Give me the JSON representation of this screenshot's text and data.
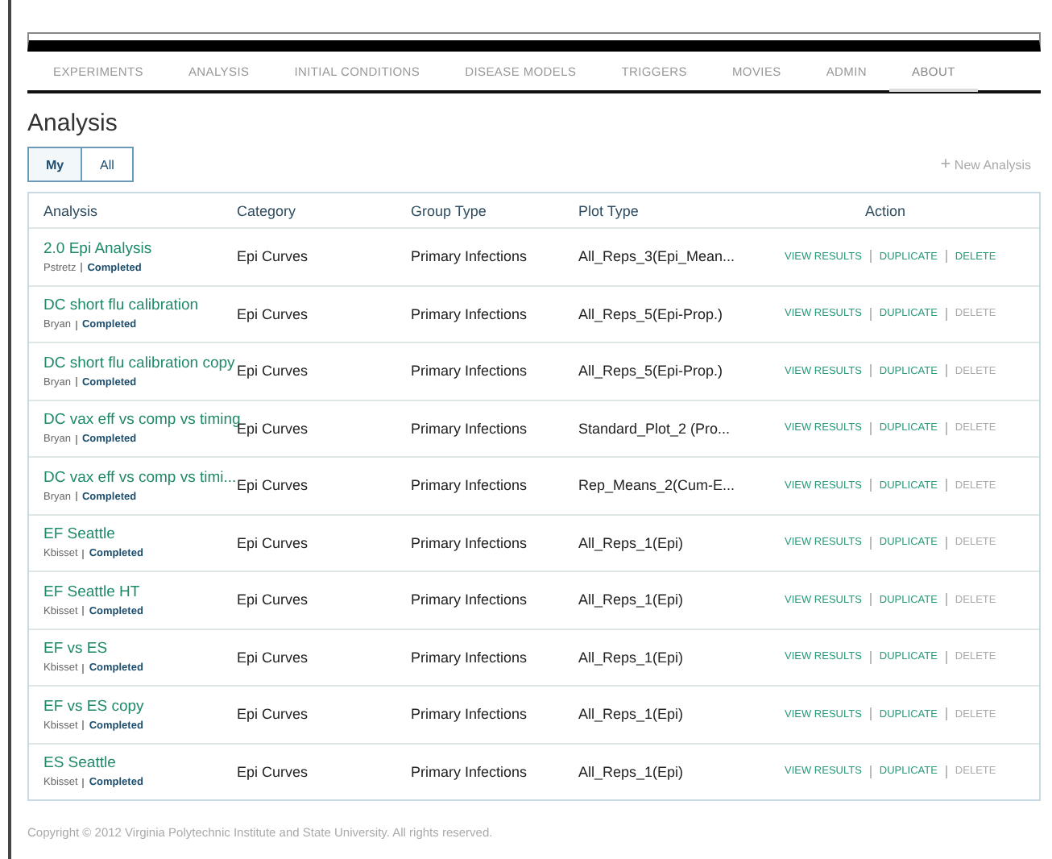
{
  "nav": [
    {
      "label": "EXPERIMENTS",
      "selected": false
    },
    {
      "label": "ANALYSIS",
      "selected": false
    },
    {
      "label": "INITIAL CONDITIONS",
      "selected": false
    },
    {
      "label": "DISEASE MODELS",
      "selected": false
    },
    {
      "label": "TRIGGERS",
      "selected": false
    },
    {
      "label": "MOVIES",
      "selected": false
    },
    {
      "label": "ADMIN",
      "selected": false
    },
    {
      "label": "ABOUT",
      "selected": true
    }
  ],
  "page_title": "Analysis",
  "filters": [
    {
      "label": "My",
      "selected": true
    },
    {
      "label": "All",
      "selected": false
    }
  ],
  "new_button": {
    "icon": "+",
    "label": "New Analysis"
  },
  "table": {
    "columns": [
      "Analysis",
      "Category",
      "Group Type",
      "Plot Type",
      "Action"
    ],
    "rows": [
      {
        "name": "2.0 Epi Analysis",
        "owner": "Pstretz",
        "status": "Completed",
        "category": "Epi Curves",
        "group_type": "Primary Infections",
        "plot_type": "All_Reps_3(Epi_Mean...",
        "actions": [
          {
            "label": "VIEW RESULTS",
            "disabled": false
          },
          {
            "label": "DUPLICATE",
            "disabled": false
          },
          {
            "label": "DELETE",
            "disabled": false
          }
        ]
      },
      {
        "name": "DC short flu calibration",
        "owner": "Bryan",
        "status": "Completed",
        "category": "Epi Curves",
        "group_type": "Primary Infections",
        "plot_type": "All_Reps_5(Epi-Prop.)",
        "actions": [
          {
            "label": "VIEW RESULTS",
            "disabled": false
          },
          {
            "label": "DUPLICATE",
            "disabled": false
          },
          {
            "label": "DELETE",
            "disabled": true
          }
        ]
      },
      {
        "name": "DC short flu calibration copy",
        "owner": "Bryan",
        "status": "Completed",
        "category": "Epi Curves",
        "group_type": "Primary Infections",
        "plot_type": "All_Reps_5(Epi-Prop.)",
        "actions": [
          {
            "label": "VIEW RESULTS",
            "disabled": false
          },
          {
            "label": "DUPLICATE",
            "disabled": false
          },
          {
            "label": "DELETE",
            "disabled": true
          }
        ]
      },
      {
        "name": "DC vax eff vs comp vs timing",
        "owner": "Bryan",
        "status": "Completed",
        "category": "Epi Curves",
        "group_type": "Primary Infections",
        "plot_type": "Standard_Plot_2 (Pro...",
        "actions": [
          {
            "label": "VIEW RESULTS",
            "disabled": false
          },
          {
            "label": "DUPLICATE",
            "disabled": false
          },
          {
            "label": "DELETE",
            "disabled": true
          }
        ]
      },
      {
        "name": "DC vax eff vs comp vs timi...",
        "owner": "Bryan",
        "status": "Completed",
        "category": "Epi Curves",
        "group_type": "Primary Infections",
        "plot_type": "Rep_Means_2(Cum-E...",
        "actions": [
          {
            "label": "VIEW RESULTS",
            "disabled": false
          },
          {
            "label": "DUPLICATE",
            "disabled": false
          },
          {
            "label": "DELETE",
            "disabled": true
          }
        ]
      },
      {
        "name": "EF Seattle",
        "owner": "Kbisset",
        "status": "Completed",
        "category": "Epi Curves",
        "group_type": "Primary Infections",
        "plot_type": "All_Reps_1(Epi)",
        "actions": [
          {
            "label": "VIEW RESULTS",
            "disabled": false
          },
          {
            "label": "DUPLICATE",
            "disabled": false
          },
          {
            "label": "DELETE",
            "disabled": true
          }
        ]
      },
      {
        "name": "EF Seattle HT",
        "owner": "Kbisset",
        "status": "Completed",
        "category": "Epi Curves",
        "group_type": "Primary Infections",
        "plot_type": "All_Reps_1(Epi)",
        "actions": [
          {
            "label": "VIEW RESULTS",
            "disabled": false
          },
          {
            "label": "DUPLICATE",
            "disabled": false
          },
          {
            "label": "DELETE",
            "disabled": true
          }
        ]
      },
      {
        "name": "EF vs ES",
        "owner": "Kbisset",
        "status": "Completed",
        "category": "Epi Curves",
        "group_type": "Primary Infections",
        "plot_type": "All_Reps_1(Epi)",
        "actions": [
          {
            "label": "VIEW RESULTS",
            "disabled": false
          },
          {
            "label": "DUPLICATE",
            "disabled": false
          },
          {
            "label": "DELETE",
            "disabled": true
          }
        ]
      },
      {
        "name": "EF vs ES copy",
        "owner": "Kbisset",
        "status": "Completed",
        "category": "Epi Curves",
        "group_type": "Primary Infections",
        "plot_type": "All_Reps_1(Epi)",
        "actions": [
          {
            "label": "VIEW RESULTS",
            "disabled": false
          },
          {
            "label": "DUPLICATE",
            "disabled": false
          },
          {
            "label": "DELETE",
            "disabled": true
          }
        ]
      },
      {
        "name": "ES Seattle",
        "owner": "Kbisset",
        "status": "Completed",
        "category": "Epi Curves",
        "group_type": "Primary Infections",
        "plot_type": "All_Reps_1(Epi)",
        "actions": [
          {
            "label": "VIEW RESULTS",
            "disabled": false
          },
          {
            "label": "DUPLICATE",
            "disabled": false
          },
          {
            "label": "DELETE",
            "disabled": true
          }
        ]
      }
    ]
  },
  "footer": "Copyright © 2012 Virginia Polytechnic Institute and State University. All rights reserved."
}
